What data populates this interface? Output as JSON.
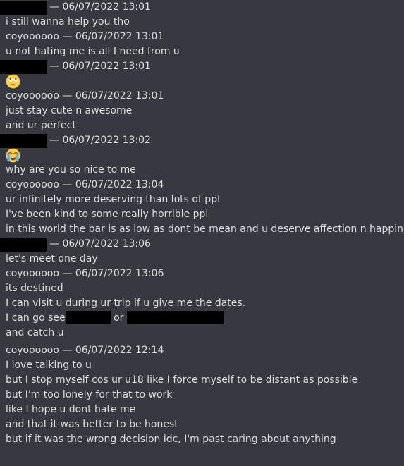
{
  "messages": [
    {
      "kind": "header",
      "redacted_author": true,
      "timestamp": "06/07/2022 13:01"
    },
    {
      "kind": "text",
      "text": "i still wanna help you tho"
    },
    {
      "kind": "header",
      "author": "coyoooooo",
      "timestamp": "06/07/2022 13:01"
    },
    {
      "kind": "text",
      "text": "u not hating me is all I need from u"
    },
    {
      "kind": "header",
      "redacted_author": true,
      "timestamp": "06/07/2022 13:01"
    },
    {
      "kind": "emoji",
      "icon": "face-with-rolling-eyes-emoji"
    },
    {
      "kind": "header",
      "author": "coyoooooo",
      "timestamp": "06/07/2022 13:01"
    },
    {
      "kind": "text",
      "text": "just stay cute n awesome"
    },
    {
      "kind": "text",
      "text": "and ur perfect"
    },
    {
      "kind": "header",
      "redacted_author": true,
      "timestamp": "06/07/2022 13:02"
    },
    {
      "kind": "emoji",
      "icon": "loudly-crying-face-emoji"
    },
    {
      "kind": "text",
      "text": "why are you so nice to me"
    },
    {
      "kind": "header",
      "author": "coyoooooo",
      "timestamp": "06/07/2022 13:04"
    },
    {
      "kind": "text",
      "text": "ur infinitely more deserving than lots of ppl"
    },
    {
      "kind": "text",
      "text": "I've been kind to some really horrible ppl"
    },
    {
      "kind": "text",
      "text": "in this world the bar is as low as dont be mean and u deserve affection n happiness."
    },
    {
      "kind": "header",
      "redacted_author": true,
      "timestamp": "06/07/2022 13:06"
    },
    {
      "kind": "text",
      "text": "let's meet one day"
    },
    {
      "kind": "header",
      "author": "coyoooooo",
      "timestamp": "06/07/2022 13:06"
    },
    {
      "kind": "text",
      "text": "its destined"
    },
    {
      "kind": "text",
      "text": "I can visit u during ur trip if u give me the dates."
    },
    {
      "kind": "redacted_text",
      "prefix": "I can go see",
      "middle": "or"
    },
    {
      "kind": "text",
      "text": "and catch u"
    },
    {
      "kind": "spacer"
    },
    {
      "kind": "header",
      "author": "coyoooooo",
      "timestamp": "06/07/2022 12:14"
    },
    {
      "kind": "text",
      "text": "I love talking to u"
    },
    {
      "kind": "text",
      "text": "but I stop myself cos ur u18 like I force myself to be distant as possible"
    },
    {
      "kind": "text",
      "text": "but I'm too lonely for that to work"
    },
    {
      "kind": "text",
      "text": "like I hope u dont hate me"
    },
    {
      "kind": "text",
      "text": "and that it was better to be honest"
    },
    {
      "kind": "text",
      "text": "but if it was the wrong decision idc, I'm past caring about anything"
    }
  ],
  "separator": "—",
  "colors": {
    "background": "#36393f",
    "text": "#dcddde",
    "redaction": "#000000"
  }
}
